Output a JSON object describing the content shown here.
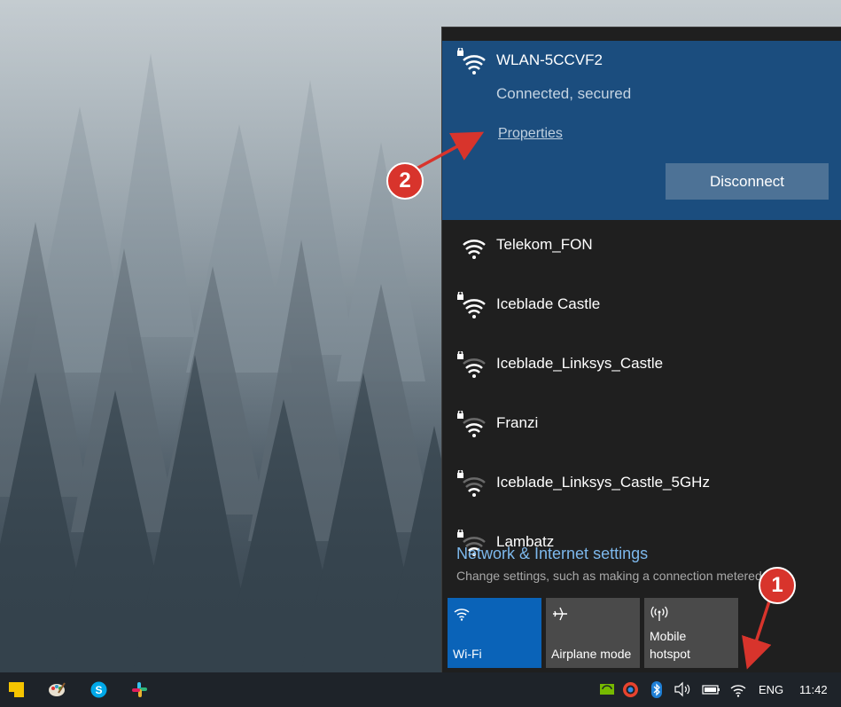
{
  "connected_network": {
    "name": "WLAN-5CCVF2",
    "status": "Connected, secured",
    "properties_label": "Properties",
    "disconnect_label": "Disconnect"
  },
  "networks": [
    {
      "name": "Telekom_FON",
      "secured": false,
      "icon": "wifi-strong-icon"
    },
    {
      "name": "Iceblade Castle",
      "secured": true,
      "icon": "wifi-secured-strong-icon"
    },
    {
      "name": "Iceblade_Linksys_Castle",
      "secured": true,
      "icon": "wifi-secured-medium-icon"
    },
    {
      "name": "Franzi",
      "secured": true,
      "icon": "wifi-secured-medium-icon"
    },
    {
      "name": "Iceblade_Linksys_Castle_5GHz",
      "secured": true,
      "icon": "wifi-secured-weak-icon"
    },
    {
      "name": "Lambatz",
      "secured": true,
      "icon": "wifi-secured-weak-icon"
    }
  ],
  "settings": {
    "link_label": "Network & Internet settings",
    "description": "Change settings, such as making a connection metered."
  },
  "quick_actions": [
    {
      "label": "Wi-Fi",
      "active": true,
      "icon": "wifi-icon"
    },
    {
      "label": "Airplane mode",
      "active": false,
      "icon": "airplane-icon"
    },
    {
      "label": "Mobile\nhotspot",
      "active": false,
      "icon": "hotspot-icon"
    }
  ],
  "taskbar": {
    "pinned_apps": [
      "sticky-notes-icon",
      "paint-icon",
      "skype-icon",
      "slack-icon"
    ],
    "tray_icons": [
      "nvidia-icon",
      "edge-icon",
      "bluetooth-icon",
      "volume-icon",
      "battery-icon",
      "wifi-tray-icon"
    ],
    "language": "ENG",
    "time": "11:42"
  },
  "annotations": [
    {
      "number": "1"
    },
    {
      "number": "2"
    }
  ],
  "colors": {
    "accent": "#0a63b8",
    "connected_bg": "#1b4d7e",
    "flyout_bg": "#1f1f1f",
    "link": "#7db8ec",
    "annotation": "#d8342c"
  }
}
